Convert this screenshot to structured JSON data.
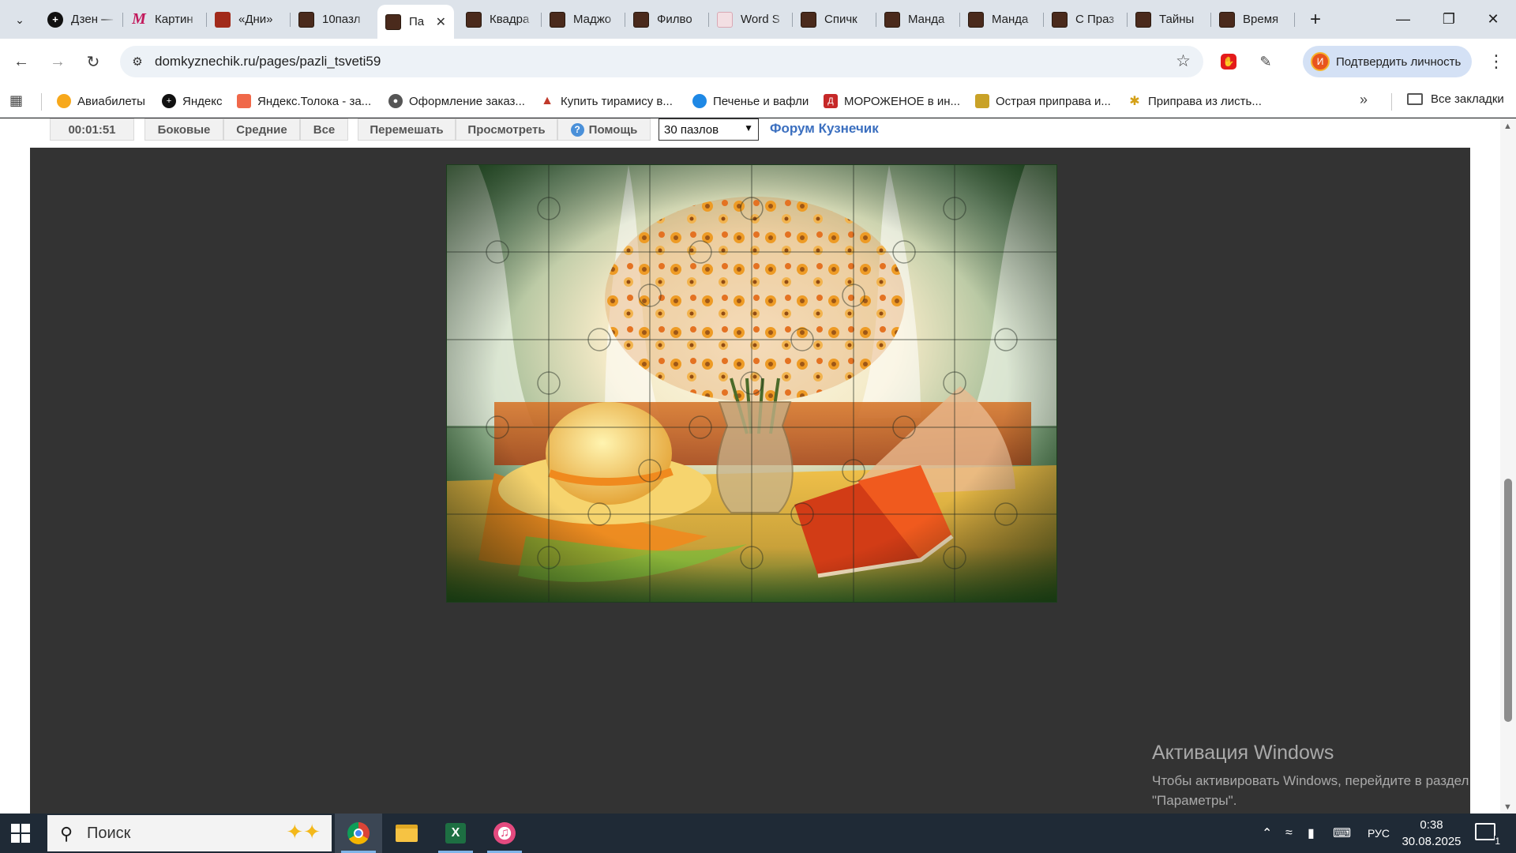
{
  "tabs": [
    {
      "title": "Дзен —",
      "favicon": "dzen-icon"
    },
    {
      "title": "Картин",
      "favicon": "m-icon"
    },
    {
      "title": "«Дни»",
      "favicon": "red-icon"
    },
    {
      "title": "10пазл",
      "favicon": "puzzle-site-icon"
    },
    {
      "title": "Па",
      "favicon": "puzzle-site-icon",
      "active": true
    },
    {
      "title": "Квадра",
      "favicon": "puzzle-site-icon"
    },
    {
      "title": "Маджо",
      "favicon": "puzzle-site-icon"
    },
    {
      "title": "Филво",
      "favicon": "puzzle-site-icon"
    },
    {
      "title": "Word S",
      "favicon": "word-icon"
    },
    {
      "title": "Спичк",
      "favicon": "puzzle-site-icon"
    },
    {
      "title": "Манда",
      "favicon": "puzzle-site-icon"
    },
    {
      "title": "Манда",
      "favicon": "puzzle-site-icon"
    },
    {
      "title": "С Праз",
      "favicon": "puzzle-site-icon"
    },
    {
      "title": "Тайны",
      "favicon": "puzzle-site-icon"
    },
    {
      "title": "Время",
      "favicon": "puzzle-site-icon"
    }
  ],
  "address": {
    "url": "domkyznechik.ru/pages/pazli_tsveti59"
  },
  "profile": {
    "initial": "И",
    "label": "Подтвердить личность"
  },
  "bookmarks": [
    {
      "label": "Авиабилеты",
      "icon": "aviasales-icon",
      "color": "#f7a81b"
    },
    {
      "label": "Яндекс",
      "icon": "yandex-icon",
      "color": "#111111"
    },
    {
      "label": "Яндекс.Толока - за...",
      "icon": "toloka-icon",
      "color": "#f0684a"
    },
    {
      "label": "Оформление заказ...",
      "icon": "globe-icon",
      "color": "#555555"
    },
    {
      "label": "Купить тирамису в...",
      "icon": "tiramisu-icon",
      "color": "#c0392b"
    },
    {
      "label": "Печенье и вафли",
      "icon": "cookies-icon",
      "color": "#1e88e5"
    },
    {
      "label": "МОРОЖЕНОЕ в ин...",
      "icon": "icecream-icon",
      "color": "#c62828"
    },
    {
      "label": "Острая приправа и...",
      "icon": "spice-icon",
      "color": "#c9a227"
    },
    {
      "label": "Приправа из листь...",
      "icon": "herb-icon",
      "color": "#d4a017"
    }
  ],
  "all_bookmarks": "Все закладки",
  "puzzle_toolbar": {
    "timer": "00:01:51",
    "side_label": "Боковые",
    "middle_label": "Средние",
    "all_label": "Все",
    "shuffle_label": "Перемешать",
    "preview_label": "Просмотреть",
    "help_label": "Помощь",
    "pieces_selected": "30 пазлов",
    "forum_link": "Форум Кузнечик"
  },
  "windows_activation": {
    "title": "Активация Windows",
    "line1": "Чтобы активировать Windows, перейдите в раздел",
    "line2": "\"Параметры\"."
  },
  "taskbar": {
    "search_placeholder": "Поиск",
    "language": "РУС",
    "time": "0:38",
    "date": "30.08.2025",
    "notifications": "1"
  }
}
